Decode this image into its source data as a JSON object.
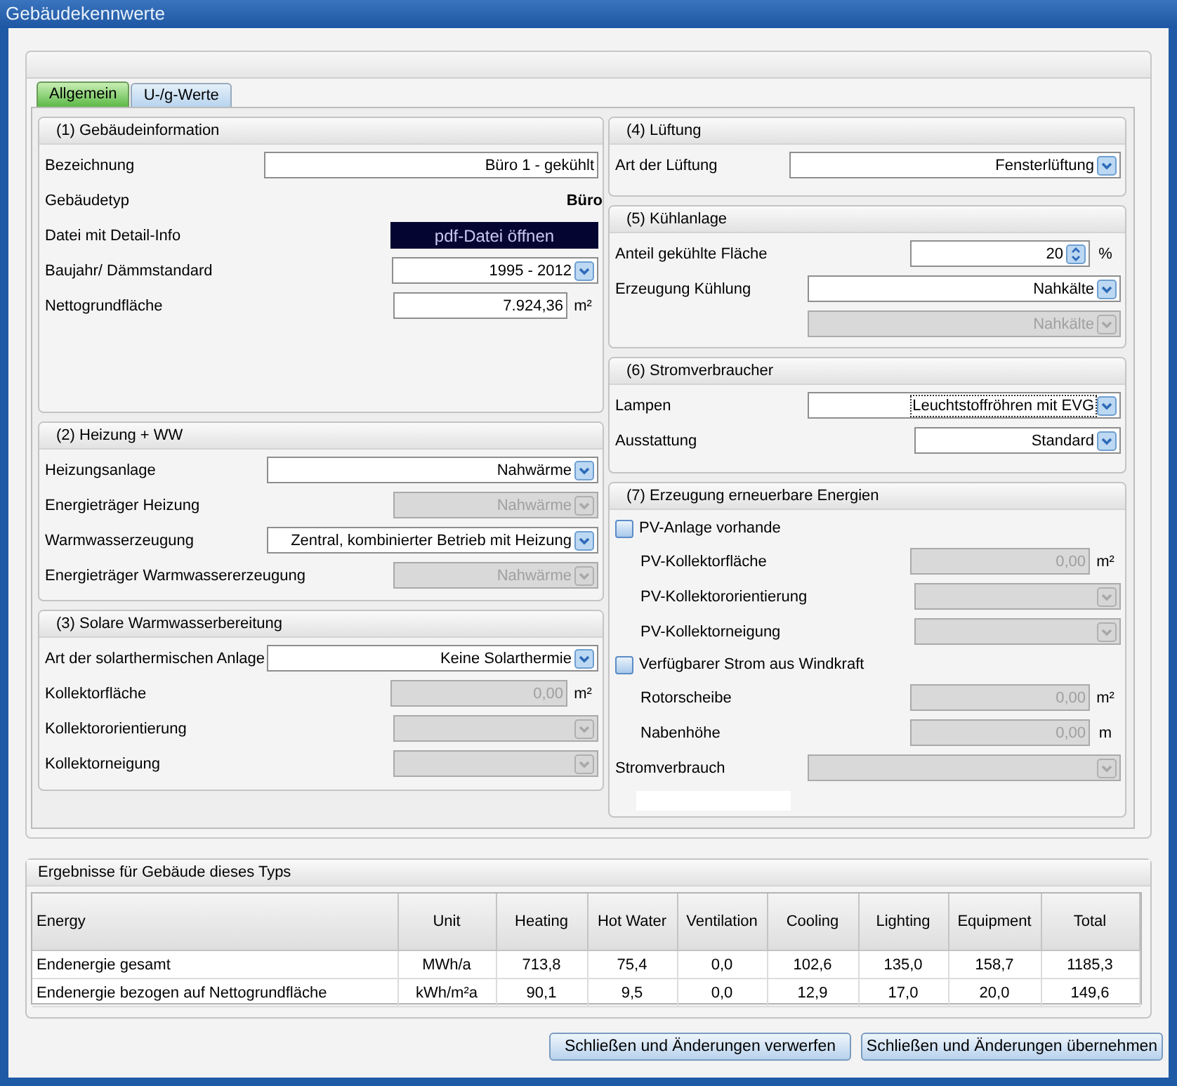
{
  "window": {
    "title": "Gebäudekennwerte"
  },
  "tabs": [
    {
      "label": "Allgemein",
      "selected": true
    },
    {
      "label": "U-/g-Werte",
      "selected": false
    }
  ],
  "left_sections": [
    {
      "title": "(1) Gebäudeinformation",
      "rows": [
        {
          "kind": "text",
          "label": "Bezeichnung",
          "value": "Büro 1 - gekühlt"
        },
        {
          "kind": "info",
          "label": "Gebäudetyp",
          "value": "Büro"
        },
        {
          "kind": "button",
          "label": "Datei mit Detail-Info",
          "value": "pdf-Datei öffnen"
        },
        {
          "kind": "combo",
          "label": "Baujahr/ Dämmstandard",
          "value": "1995 - 2012",
          "disabled": false
        },
        {
          "kind": "number",
          "label": "Nettogrundfläche",
          "value": "7.924,36",
          "unit": "m²",
          "disabled": false
        }
      ]
    },
    {
      "title": "(2) Heizung + WW",
      "rows": [
        {
          "kind": "combo",
          "label": "Heizungsanlage",
          "value": "Nahwärme",
          "disabled": false
        },
        {
          "kind": "combo",
          "label": "Energieträger Heizung",
          "value": "Nahwärme",
          "disabled": true
        },
        {
          "kind": "combo",
          "label": "Warmwasserzeugung",
          "value": "Zentral, kombinierter Betrieb mit Heizung",
          "disabled": false
        },
        {
          "kind": "combo",
          "label": "Energieträger Warmwassererzeugung",
          "value": "Nahwärme",
          "disabled": true
        }
      ]
    },
    {
      "title": "(3) Solare Warmwasserbereitung",
      "rows": [
        {
          "kind": "combo",
          "label": "Art der solarthermischen Anlage",
          "value": "Keine Solarthermie",
          "disabled": false
        },
        {
          "kind": "number",
          "label": "Kollektorfläche",
          "value": "0,00",
          "unit": "m²",
          "disabled": true
        },
        {
          "kind": "combo",
          "label": "Kollektororientierung",
          "disabled": true
        },
        {
          "kind": "combo",
          "label": "Kollektorneigung",
          "disabled": true
        }
      ]
    }
  ],
  "right_sections": [
    {
      "title": "(4) Lüftung",
      "rows": [
        {
          "kind": "combo",
          "label": "Art der Lüftung",
          "value": "Fensterlüftung",
          "disabled": false
        }
      ]
    },
    {
      "title": "(5) Kühlanlage",
      "rows": [
        {
          "kind": "spin",
          "label": "Anteil gekühlte Fläche",
          "value": "20",
          "unit": "%",
          "disabled": false
        },
        {
          "kind": "combo",
          "label": "Erzeugung Kühlung",
          "value": "Nahkälte",
          "disabled": false
        },
        {
          "kind": "combo",
          "value": "Nahkälte",
          "disabled": true
        }
      ]
    },
    {
      "title": "(6) Stromverbraucher",
      "rows": [
        {
          "kind": "combo",
          "label": "Lampen",
          "value": "Leuchtstoffröhren mit EVG",
          "disabled": false,
          "focused": true
        },
        {
          "kind": "combo",
          "label": "Ausstattung",
          "value": "Standard",
          "disabled": false,
          "focused": false
        }
      ]
    },
    {
      "title": "(7) Erzeugung erneuerbare Energien",
      "rows": [
        {
          "kind": "checkbox",
          "label": "PV-Anlage vorhande",
          "checked": false,
          "children": [
            {
              "kind": "number",
              "label": "PV-Kollektorfläche",
              "value": "0,00",
              "unit": "m²",
              "disabled": true
            },
            {
              "kind": "combo",
              "label": "PV-Kollektororientierung",
              "disabled": true
            },
            {
              "kind": "combo",
              "label": "PV-Kollektorneigung",
              "disabled": true
            }
          ]
        },
        {
          "kind": "checkbox",
          "label": "Verfügbarer Strom aus Windkraft",
          "checked": false,
          "children": [
            {
              "kind": "number",
              "label": "Rotorscheibe",
              "value": "0,00",
              "unit": "m²",
              "disabled": true
            },
            {
              "kind": "number",
              "label": "Nabenhöhe",
              "value": "0,00",
              "unit": "m",
              "disabled": true
            }
          ]
        },
        {
          "kind": "combo",
          "label": "Stromverbrauch",
          "disabled": true
        },
        {
          "kind": "blank"
        }
      ]
    }
  ],
  "results": {
    "title": "Ergebnisse für Gebäude dieses Typs",
    "columns": [
      "Energy",
      "Unit",
      "Heating",
      "Hot Water",
      "Ventilation",
      "Cooling",
      "Lighting",
      "Equipment",
      "Total"
    ],
    "rows": [
      [
        "Endenergie gesamt",
        "MWh/a",
        "713,8",
        "75,4",
        "0,0",
        "102,6",
        "135,0",
        "158,7",
        "1185,3"
      ],
      [
        "Endenergie bezogen auf Nettogrundfläche",
        "kWh/m²a",
        "90,1",
        "9,5",
        "0,0",
        "12,9",
        "17,0",
        "20,0",
        "149,6"
      ]
    ]
  },
  "buttons": [
    {
      "label": "Schließen und Änderungen verwerfen"
    },
    {
      "label": "Schließen und Änderungen übernehmen"
    }
  ]
}
